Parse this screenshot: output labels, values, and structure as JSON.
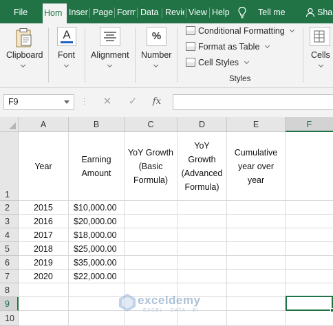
{
  "ribbon_tabs": [
    {
      "label": "File",
      "active": false
    },
    {
      "label": "Hom",
      "active": true
    },
    {
      "label": "Inser",
      "active": false
    },
    {
      "label": "Page",
      "active": false
    },
    {
      "label": "Form",
      "active": false
    },
    {
      "label": "Data",
      "active": false
    },
    {
      "label": "Revie",
      "active": false
    },
    {
      "label": "View",
      "active": false
    },
    {
      "label": "Help",
      "active": false
    }
  ],
  "tell_me": "Tell me",
  "share": "Shar",
  "groups": {
    "clipboard": "Clipboard",
    "font": "Font",
    "alignment": "Alignment",
    "number": "Number",
    "number_symbol": "%",
    "cells": "Cells",
    "styles_title": "Styles",
    "conditional_formatting": "Conditional Formatting",
    "format_as_table": "Format as Table",
    "cell_styles": "Cell Styles",
    "font_icon_letter": "A"
  },
  "formula_bar": {
    "name_box": "F9",
    "cancel_symbol": "✕",
    "enter_symbol": "✓",
    "fx_symbol": "fx",
    "value": ""
  },
  "sheet": {
    "columns": [
      "A",
      "B",
      "C",
      "D",
      "E",
      "F"
    ],
    "rows": [
      "1",
      "2",
      "3",
      "4",
      "5",
      "6",
      "7",
      "8",
      "9",
      "10"
    ],
    "selected_column": "F",
    "selected_row": "9",
    "headers": {
      "A1": "Year",
      "B1": "Earning\nAmount",
      "C1": "YoY Growth\n(Basic\nFormula)",
      "D1": "YoY\nGrowth\n(Advanced\nFormula)",
      "E1": "Cumulative\nyear over\nyear"
    },
    "data_rows": [
      {
        "year": "2015",
        "amount": "$10,000.00"
      },
      {
        "year": "2016",
        "amount": "$20,000.00"
      },
      {
        "year": "2017",
        "amount": "$18,000.00"
      },
      {
        "year": "2018",
        "amount": "$25,000.00"
      },
      {
        "year": "2019",
        "amount": "$35,000.00"
      },
      {
        "year": "2020",
        "amount": "$22,000.00"
      }
    ]
  },
  "watermark": {
    "name": "exceldemy",
    "tagline": "EXCEL · DATA · BI"
  },
  "colors": {
    "ribbon_green": "#217346",
    "selection_green": "#217346"
  }
}
